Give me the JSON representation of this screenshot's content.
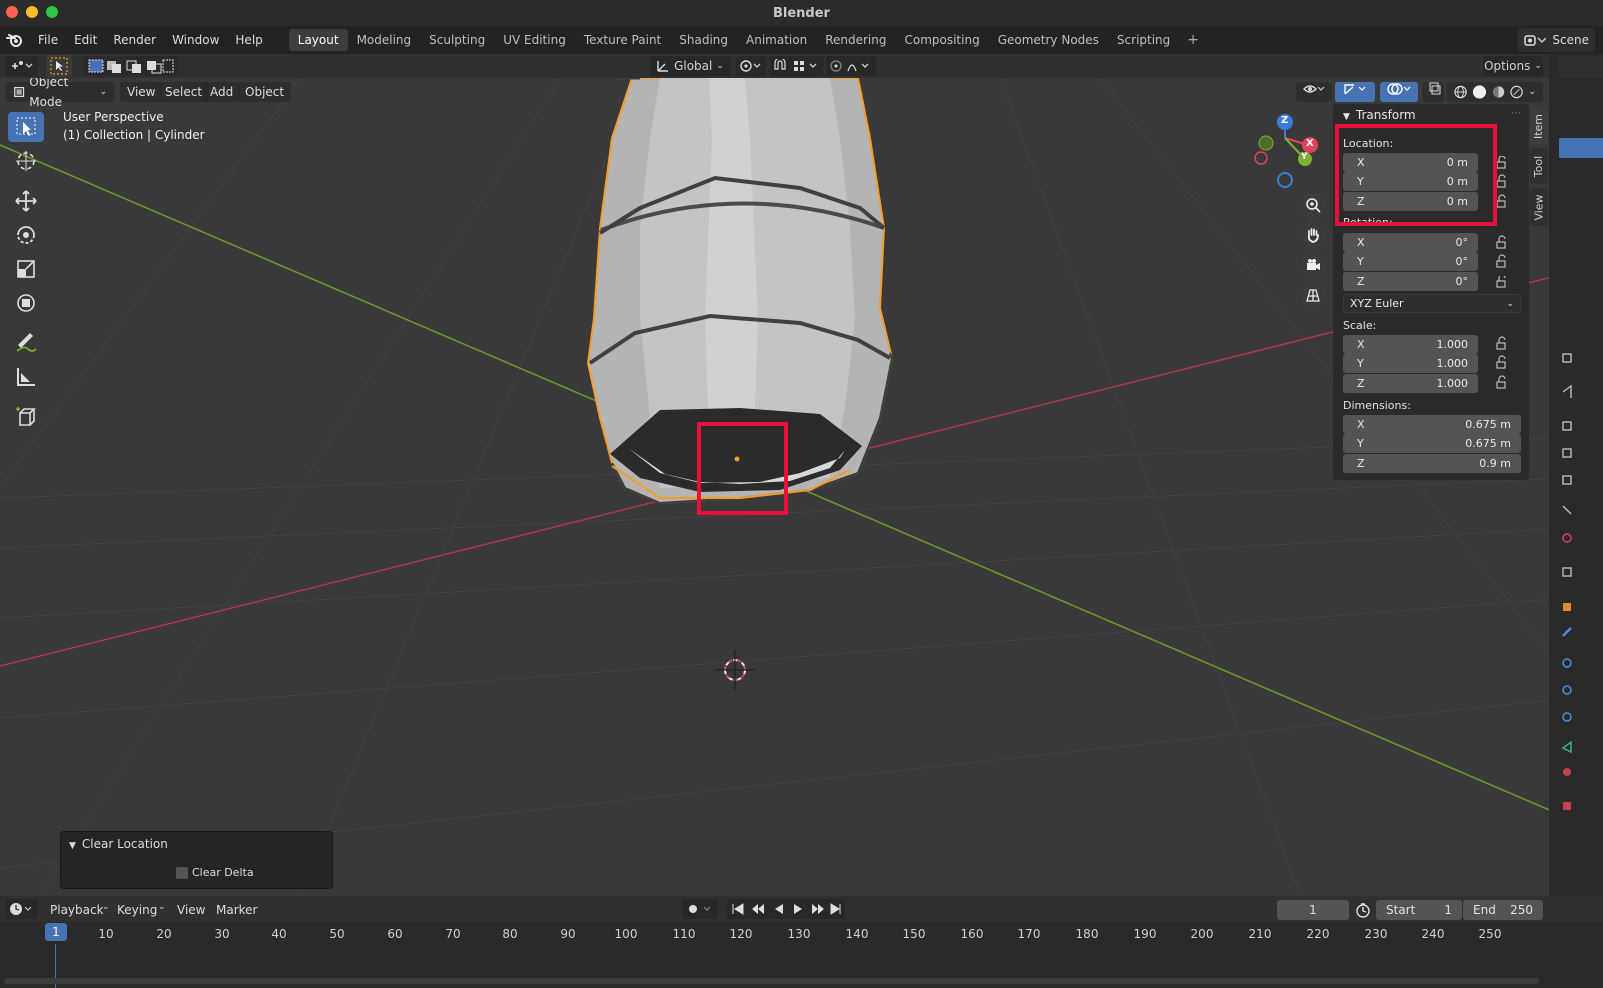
{
  "window": {
    "title": "Blender"
  },
  "menu": [
    "File",
    "Edit",
    "Render",
    "Window",
    "Help"
  ],
  "workspace_tabs": [
    "Layout",
    "Modeling",
    "Sculpting",
    "UV Editing",
    "Texture Paint",
    "Shading",
    "Animation",
    "Rendering",
    "Compositing",
    "Geometry Nodes",
    "Scripting"
  ],
  "active_tab": "Layout",
  "scene": {
    "label": "Scene"
  },
  "header": {
    "transform_orientation": "Global",
    "options_label": "Options"
  },
  "viewport_header": {
    "mode": "Object Mode",
    "items": [
      "View",
      "Select",
      "Add",
      "Object"
    ]
  },
  "viewport_info": {
    "perspective": "User Perspective",
    "collection": "(1) Collection | Cylinder"
  },
  "gizmo": {
    "x": "X",
    "y": "Y",
    "z": "Z"
  },
  "npanel": {
    "title": "Transform",
    "location_label": "Location:",
    "location": [
      {
        "axis": "X",
        "value": "0 m"
      },
      {
        "axis": "Y",
        "value": "0 m"
      },
      {
        "axis": "Z",
        "value": "0 m"
      }
    ],
    "rotation_label": "Rotation:",
    "rotation": [
      {
        "axis": "X",
        "value": "0°"
      },
      {
        "axis": "Y",
        "value": "0°"
      },
      {
        "axis": "Z",
        "value": "0°"
      }
    ],
    "rotation_mode": "XYZ Euler",
    "scale_label": "Scale:",
    "scale": [
      {
        "axis": "X",
        "value": "1.000"
      },
      {
        "axis": "Y",
        "value": "1.000"
      },
      {
        "axis": "Z",
        "value": "1.000"
      }
    ],
    "dimensions_label": "Dimensions:",
    "dimensions": [
      {
        "axis": "X",
        "value": "0.675 m"
      },
      {
        "axis": "Y",
        "value": "0.675 m"
      },
      {
        "axis": "Z",
        "value": "0.9 m"
      }
    ],
    "side_tabs": [
      "Item",
      "Tool",
      "View"
    ]
  },
  "operator_panel": {
    "title": "Clear Location",
    "checkbox_label": "Clear Delta",
    "checked": false
  },
  "timeline": {
    "menus": [
      "Playback",
      "Keying",
      "View",
      "Marker"
    ],
    "current_frame": "1",
    "start_label": "Start",
    "start": "1",
    "end_label": "End",
    "end": "250",
    "ticks": [
      "1",
      "10",
      "20",
      "30",
      "40",
      "50",
      "60",
      "70",
      "80",
      "90",
      "100",
      "110",
      "120",
      "130",
      "140",
      "150",
      "160",
      "170",
      "180",
      "190",
      "200",
      "210",
      "220",
      "230",
      "240",
      "250"
    ]
  },
  "colors": {
    "accent": "#4772b3",
    "highlight": "#e8103a",
    "selection_outline": "#f39c2a",
    "x_axis": "#e0445c",
    "y_axis": "#7bb234",
    "z_axis": "#3d7dd8"
  }
}
